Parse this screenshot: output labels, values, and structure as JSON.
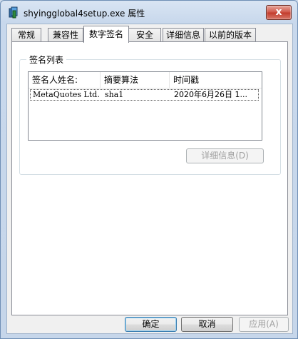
{
  "window": {
    "title": "shyingglobal4setup.exe 属性",
    "close_glyph": "x"
  },
  "tabs": [
    {
      "label": "常规"
    },
    {
      "label": "兼容性"
    },
    {
      "label": "数字签名"
    },
    {
      "label": "安全"
    },
    {
      "label": "详细信息"
    },
    {
      "label": "以前的版本"
    }
  ],
  "active_tab": "数字签名",
  "signature_list": {
    "group_label": "签名列表",
    "columns": [
      "签名人姓名:",
      "摘要算法",
      "时间戳"
    ],
    "rows": [
      {
        "signer": "MetaQuotes Ltd.",
        "algorithm": "sha1",
        "timestamp": "2020年6月26日 1..."
      }
    ],
    "details_button": "详细信息(D)"
  },
  "footer": {
    "ok_label": "确定",
    "cancel_label": "取消",
    "apply_label": "应用(A)"
  },
  "colors": {
    "close_button": "#c23c2c",
    "title_bar": "#c8d8ec"
  },
  "icons": {
    "app_icon": "installer-icon",
    "close_icon": "close-icon"
  }
}
